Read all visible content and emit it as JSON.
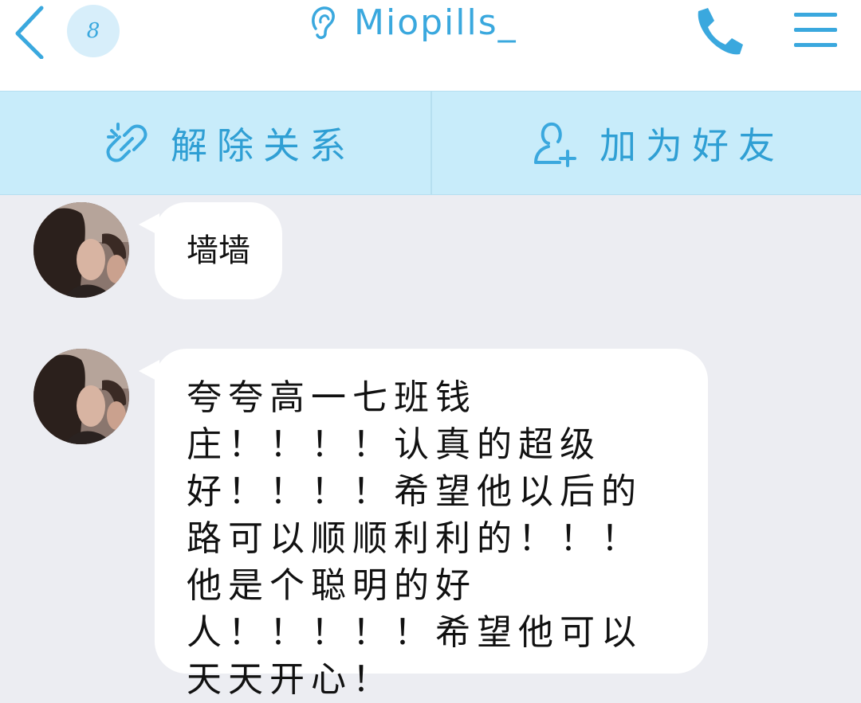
{
  "header": {
    "unread_count": "8",
    "title": "Miopills_",
    "icons": {
      "back": "chevron-left-icon",
      "title": "ear-icon",
      "call": "phone-icon",
      "menu": "hamburger-menu-icon"
    }
  },
  "actions": {
    "unlink_label": "解除关系",
    "add_friend_label": "加为好友",
    "icons": {
      "unlink": "broken-link-icon",
      "add_friend": "add-user-icon"
    }
  },
  "messages": [
    {
      "text": "墙墙"
    },
    {
      "text": "夸夸高一七班钱庄！！！！认真的超级好！！！！希望他以后的路可以顺顺利利的！！！他是个聪明的好人！！！！！希望他可以天天开心！"
    }
  ],
  "colors": {
    "accent": "#3aa8de",
    "action_bar": "#c8ecfa",
    "chat_background": "#ecedf2",
    "bubble": "#ffffff"
  }
}
